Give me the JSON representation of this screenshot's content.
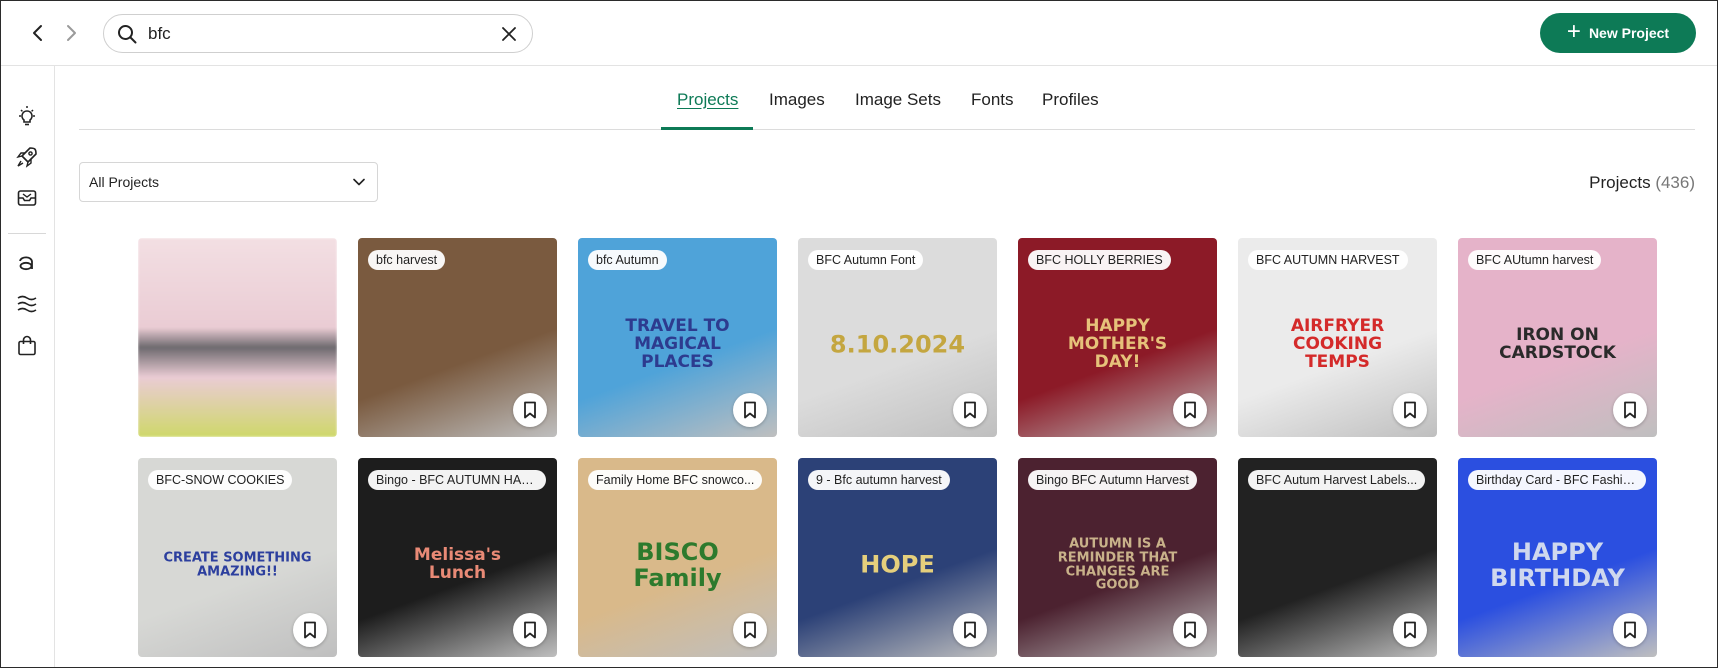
{
  "search": {
    "value": "bfc"
  },
  "new_project_label": "New Project",
  "tabs": [
    {
      "label": "Projects"
    },
    {
      "label": "Images"
    },
    {
      "label": "Image Sets"
    },
    {
      "label": "Fonts"
    },
    {
      "label": "Profiles"
    }
  ],
  "filter": {
    "selected": "All Projects"
  },
  "count": {
    "label": "Projects",
    "value": "(436)"
  },
  "rail_icons": [
    "lightbulb-icon",
    "rocket-icon",
    "inbox-icon",
    "text-font-icon",
    "wave-pattern-icon",
    "shopping-bag-icon"
  ],
  "cards": [
    {
      "label": "",
      "bg": "#f3dfe3",
      "accent": "#cfd86a",
      "art": ""
    },
    {
      "label": "bfc harvest",
      "bg": "#7a5a3f",
      "accent": "#c8d0d4",
      "art": ""
    },
    {
      "label": "bfc Autumn",
      "bg": "#4fa3d9",
      "accent": "#2d3b8f",
      "art": "TRAVEL TO MAGICAL PLACES"
    },
    {
      "label": "BFC Autumn Font",
      "bg": "#dcdcdc",
      "accent": "#c4a640",
      "art": "8.10.2024"
    },
    {
      "label": "BFC HOLLY BERRIES",
      "bg": "#8c1a27",
      "accent": "#e6c27a",
      "art": "HAPPY MOTHER'S DAY!"
    },
    {
      "label": "BFC AUTUMN HARVEST",
      "bg": "#ebebeb",
      "accent": "#d42a2a",
      "art": "AIRFRYER COOKING TEMPS"
    },
    {
      "label": "BFC AUtumn harvest",
      "bg": "#e5b3c9",
      "accent": "#2a2a2a",
      "art": "IRON ON CARDSTOCK"
    },
    {
      "label": "BFC-SNOW COOKIES",
      "bg": "#d7d8d5",
      "accent": "#2c3f9e",
      "art": "CREATE SOMETHING AMAZING!!"
    },
    {
      "label": "Bingo - BFC AUTUMN HAR...",
      "bg": "#1d1d1d",
      "accent": "#e98a76",
      "art": "Melissa's Lunch"
    },
    {
      "label": "Family Home BFC snowco...",
      "bg": "#d9b98a",
      "accent": "#2d7a2d",
      "art": "BISCO Family"
    },
    {
      "label": "9 - Bfc autumn harvest",
      "bg": "#2c4177",
      "accent": "#e5cf7c",
      "art": "HOPE"
    },
    {
      "label": "Bingo BFC Autumn Harvest",
      "bg": "#4c2230",
      "accent": "#c9b28a",
      "art": "AUTUMN IS A REMINDER THAT CHANGES ARE GOOD"
    },
    {
      "label": "BFC Autum Harvest Labels...",
      "bg": "#222222",
      "accent": "#8fd0a8",
      "art": ""
    },
    {
      "label": "Birthday Card - BFC Fashio...",
      "bg": "#2b4fe0",
      "accent": "#cfd8ee",
      "art": "HAPPY BIRTHDAY"
    }
  ]
}
